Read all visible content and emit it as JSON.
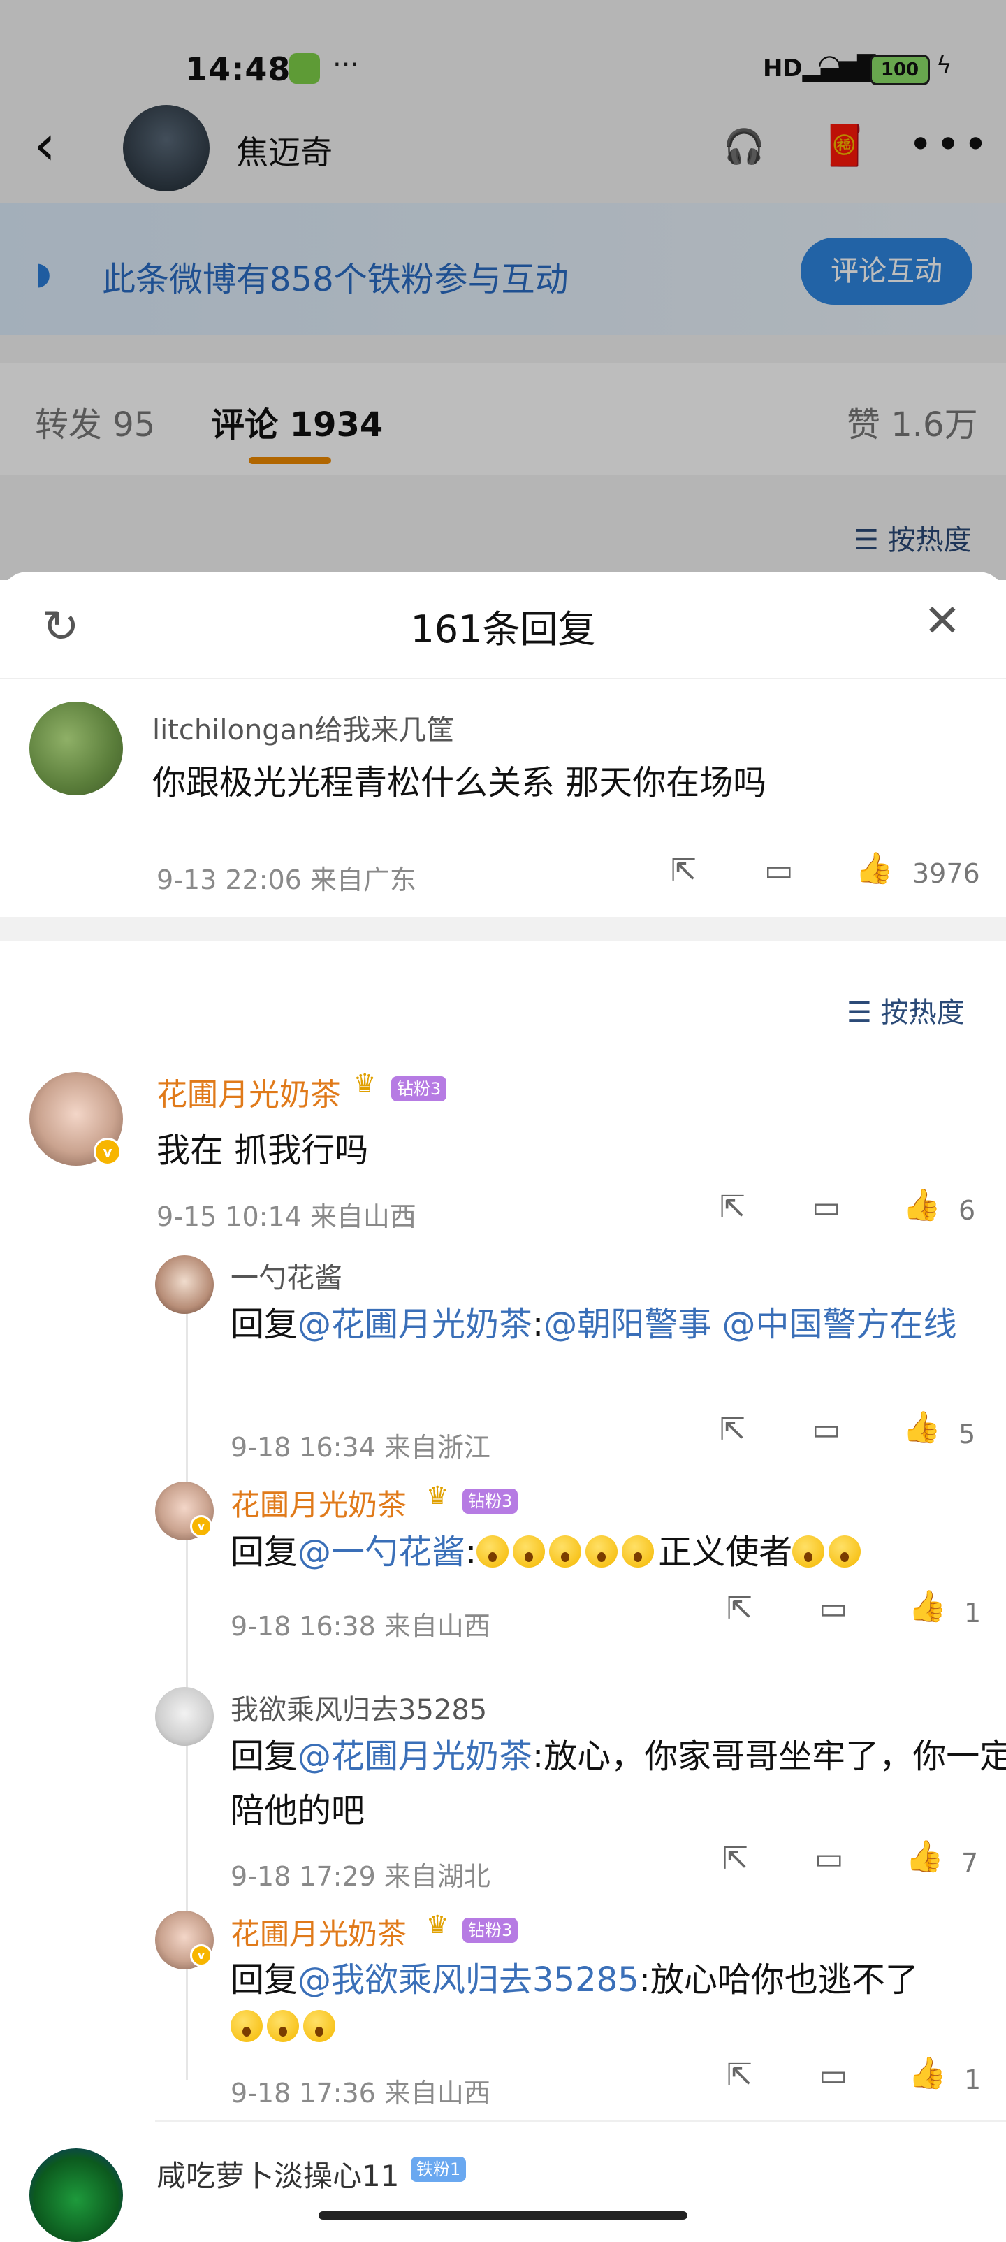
{
  "status_bar": {
    "time": "14:48",
    "battery": "100"
  },
  "header": {
    "username": "焦迈奇",
    "listen_label": "听"
  },
  "fan_bar": {
    "text": "此条微博有858个铁粉参与互动",
    "button": "评论互动"
  },
  "tabs": {
    "repost": "转发 95",
    "comments": "评论 1934",
    "likes": "赞 1.6万"
  },
  "sort_label": "按热度",
  "sheet": {
    "title": "161条回复"
  },
  "root_comment": {
    "user": "litchilongan给我来几筐",
    "text": "你跟极光光程青松什么关系 那天你在场吗",
    "meta": "9-13 22:06 来自广东",
    "likes": "3976"
  },
  "thread": {
    "user": "花圃月光奶茶",
    "badge": "钻粉3",
    "text": "我在  抓我行吗",
    "meta": "9-15 10:14 来自山西",
    "likes": "6",
    "replies": [
      {
        "user": "一勺花酱",
        "prefix": "回复",
        "mention": "@花圃月光奶茶",
        "colon": ":",
        "mention2": "@朝阳警事",
        "mention3": "@中国警方在线",
        "meta": "9-18 16:34 来自浙江",
        "likes": "5"
      },
      {
        "user": "花圃月光奶茶",
        "badge": "钻粉3",
        "prefix": "回复",
        "mention": "@一勺花酱",
        "colon": ":",
        "suffix": "正义使者",
        "meta": "9-18 16:38 来自山西",
        "likes": "1"
      },
      {
        "user": "我欲乘风归去35285",
        "prefix": "回复",
        "mention": "@花圃月光奶茶",
        "body": ":放心，你家哥哥坐牢了，你一定会陪他的吧",
        "meta": "9-18 17:29 来自湖北",
        "likes": "7"
      },
      {
        "user": "花圃月光奶茶",
        "badge": "钻粉3",
        "prefix": "回复",
        "mention": "@我欲乘风归去35285",
        "body": ":放心哈你也逃不了",
        "meta": "9-18 17:36 来自山西",
        "likes": "1"
      }
    ]
  },
  "next_comment": {
    "user": "咸吃萝卜淡操心11",
    "badge": "铁粉1"
  },
  "icons": {
    "back": "chevron-left-icon",
    "more": "more-dots-icon",
    "refresh": "refresh-icon",
    "close": "close-icon",
    "share": "share-icon",
    "comment": "comment-icon",
    "like": "thumbs-up-icon"
  },
  "colors": {
    "accent": "#ef8a00",
    "link": "#3a6fb8",
    "username": "#e07a1a",
    "button": "#2f86e0"
  }
}
